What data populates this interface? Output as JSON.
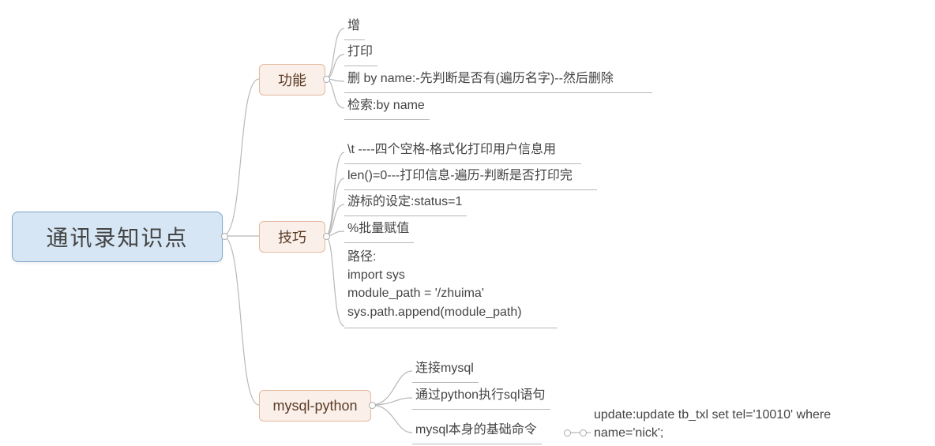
{
  "root": {
    "label": "通讯录知识点"
  },
  "branches": [
    {
      "key": "features",
      "label": "功能",
      "leaves": [
        {
          "text": "增"
        },
        {
          "text": "打印"
        },
        {
          "text": "删 by name:-先判断是否有(遍历名字)--然后删除"
        },
        {
          "text": "检索:by name"
        }
      ]
    },
    {
      "key": "tips",
      "label": "技巧",
      "leaves": [
        {
          "text": "\\t ----四个空格-格式化打印用户信息用"
        },
        {
          "text": "len()=0---打印信息-遍历-判断是否打印完"
        },
        {
          "text": "游标的设定:status=1"
        },
        {
          "text": "%批量赋值"
        },
        {
          "text": "路径:\nimport sys\nmodule_path = '/zhuima'\nsys.path.append(module_path)",
          "multi": true
        }
      ]
    },
    {
      "key": "mysql",
      "label": "mysql-python",
      "leaves": [
        {
          "text": "连接mysql"
        },
        {
          "text": "通过python执行sql语句"
        },
        {
          "text": "mysql本身的基础命令",
          "child": {
            "text": "update:update tb_txl set tel='10010' where\nname='nick';",
            "multi": true
          }
        }
      ]
    }
  ],
  "chart_data": {
    "type": "tree",
    "root": "通讯录知识点",
    "children": [
      {
        "name": "功能",
        "children": [
          "增",
          "打印",
          "删 by name:-先判断是否有(遍历名字)--然后删除",
          "检索:by name"
        ]
      },
      {
        "name": "技巧",
        "children": [
          "\\t ----四个空格-格式化打印用户信息用",
          "len()=0---打印信息-遍历-判断是否打印完",
          "游标的设定:status=1",
          "%批量赋值",
          "路径: import sys; module_path = '/zhuima'; sys.path.append(module_path)"
        ]
      },
      {
        "name": "mysql-python",
        "children": [
          "连接mysql",
          "通过python执行sql语句",
          {
            "name": "mysql本身的基础命令",
            "children": [
              "update:update tb_txl set tel='10010' where name='nick';"
            ]
          }
        ]
      }
    ]
  }
}
